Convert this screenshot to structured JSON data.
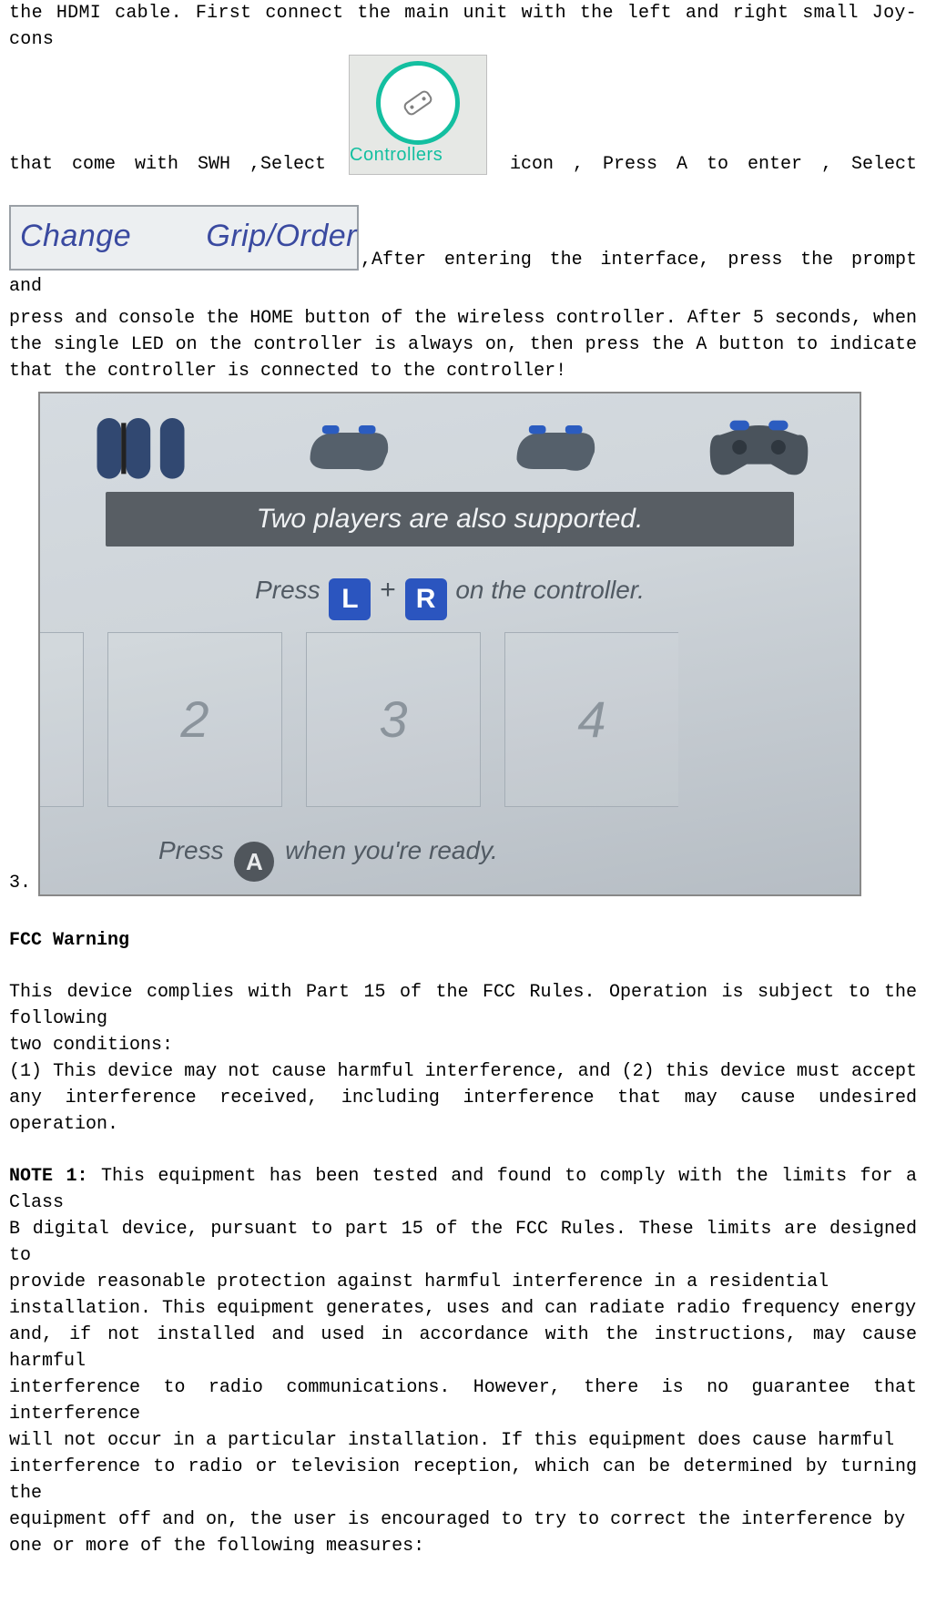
{
  "para1_line1": "the HDMI cable. First connect the main unit with the left and right small Joy-cons",
  "para1_line2_a": "that  come  with  SWH  ,Select",
  "controllers_label": "Controllers",
  "para1_line2_b": "icon ,  Press  A  to  enter ,  Select",
  "change_grip_label": "Change Grip/Order",
  "para1_line3_b": ",After entering the interface, press the prompt and",
  "para3_l1": "press and console the HOME button of the wireless controller. After 5 seconds, when",
  "para3_l2": "the single LED on the controller is always on, then press the A button to indicate",
  "para3_l3": "that the controller is connected to the controller!",
  "shot": {
    "banner": "Two players are also supported.",
    "pressLR_a": "Press",
    "pressLR_L": "L",
    "pressLR_plus": "+",
    "pressLR_R": "R",
    "pressLR_b": " on the controller.",
    "slot2": "2",
    "slot3": "3",
    "slot4": "4",
    "pressA_a": "Press",
    "pressA_A": "A",
    "pressA_b": " when you're ready."
  },
  "item3_num": "3.",
  "fcc": {
    "heading": "FCC Warning",
    "p1_l1": "This device complies with Part 15 of the FCC Rules. Operation is subject to the following",
    "p1_l2": "two conditions:",
    "p2_l1": "(1) This device may not cause harmful interference, and (2) this device must accept",
    "p2_l2": "any interference received, including interference that may cause undesired operation.",
    "note_bold": "NOTE 1:",
    "note_l1_rest": " This equipment has been tested and found to comply with the limits for a Class",
    "note_l2": "B digital device, pursuant to part 15 of the FCC Rules. These limits are designed to",
    "note_l3": "provide  reasonable  protection  against  harmful  interference  in  a  residential",
    "note_l4": "installation. This equipment generates, uses and can radiate radio frequency energy",
    "note_l5": "and, if not installed and used in accordance with the instructions, may cause harmful",
    "note_l6": "interference to radio communications. However, there is no guarantee that interference",
    "note_l7": "will not occur in a particular installation. If this equipment does cause harmful",
    "note_l8": "interference to radio or television reception, which can be determined by turning the",
    "note_l9": "equipment off and on, the user is encouraged to try to correct the interference by",
    "note_l10": "one or more of the following measures:"
  }
}
